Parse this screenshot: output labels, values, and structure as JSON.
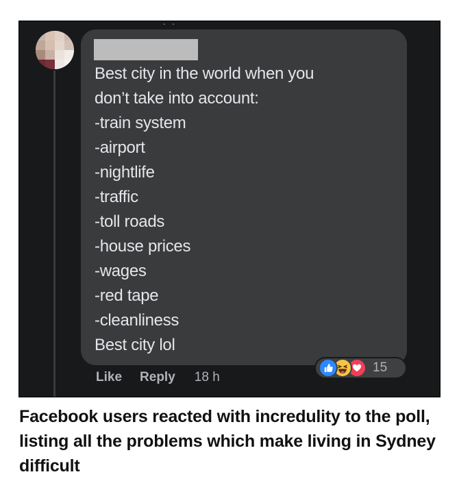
{
  "colors": {
    "background": "#18191a",
    "bubble": "#3a3b3c",
    "comment_text": "#e4e6eb",
    "secondary_text": "#b0b3b8",
    "like_blue": "#2d88ff",
    "haha_yellow": "#f7c544",
    "love_red": "#f33e58"
  },
  "comment": {
    "lines": [
      "Best city in the world when you",
      "don’t take into account:",
      "-train system",
      "-airport",
      "-nightlife",
      "-traffic",
      "-toll roads",
      "-house prices",
      "-wages",
      "-red tape",
      "-cleanliness",
      "Best city lol"
    ]
  },
  "actions": {
    "like_label": "Like",
    "reply_label": "Reply",
    "timestamp": "18 h"
  },
  "reactions": {
    "icons": [
      "like-reaction-icon",
      "haha-reaction-icon",
      "love-reaction-icon"
    ],
    "count": "15"
  },
  "caption": "Facebook users reacted with incredulity to the poll, listing all the problems which make living in Sydney difficult"
}
